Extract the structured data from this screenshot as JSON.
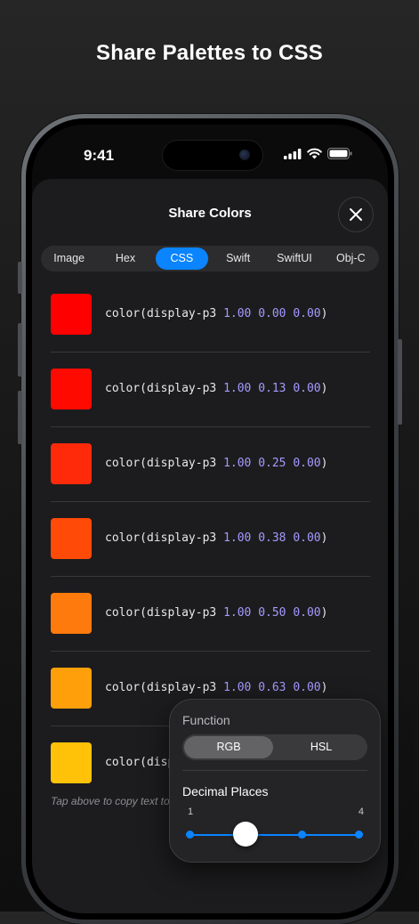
{
  "headline": "Share Palettes to CSS",
  "status": {
    "time": "9:41"
  },
  "sheet": {
    "title": "Share Colors",
    "close_icon": "close-icon"
  },
  "tabs": [
    {
      "label": "Image",
      "active": false
    },
    {
      "label": "Hex",
      "active": false
    },
    {
      "label": "CSS",
      "active": true
    },
    {
      "label": "Swift",
      "active": false
    },
    {
      "label": "SwiftUI",
      "active": false
    },
    {
      "label": "Obj-C",
      "active": false
    }
  ],
  "colors": [
    {
      "swatch": "#ff0000",
      "prefix": "color(display-p3 ",
      "values": "1.00 0.00 0.00",
      "suffix": ")"
    },
    {
      "swatch": "#ff0a00",
      "prefix": "color(display-p3 ",
      "values": "1.00 0.13 0.00",
      "suffix": ")"
    },
    {
      "swatch": "#ff2a0a",
      "prefix": "color(display-p3 ",
      "values": "1.00 0.25 0.00",
      "suffix": ")"
    },
    {
      "swatch": "#ff4a08",
      "prefix": "color(display-p3 ",
      "values": "1.00 0.38 0.00",
      "suffix": ")"
    },
    {
      "swatch": "#ff7a0c",
      "prefix": "color(display-p3 ",
      "values": "1.00 0.50 0.00",
      "suffix": ")"
    },
    {
      "swatch": "#ffa00a",
      "prefix": "color(display-p3 ",
      "values": "1.00 0.63 0.00",
      "suffix": ")"
    },
    {
      "swatch": "#ffc208",
      "prefix": "color(disp",
      "values": "",
      "suffix": ""
    }
  ],
  "hint": "Tap above to copy text to",
  "popover": {
    "function_label": "Function",
    "function_options": [
      {
        "label": "RGB",
        "active": true
      },
      {
        "label": "HSL",
        "active": false
      }
    ],
    "decimal_label": "Decimal Places",
    "slider_min": "1",
    "slider_max": "4",
    "slider_value": 2
  },
  "colors_accent": "#0a84ff"
}
